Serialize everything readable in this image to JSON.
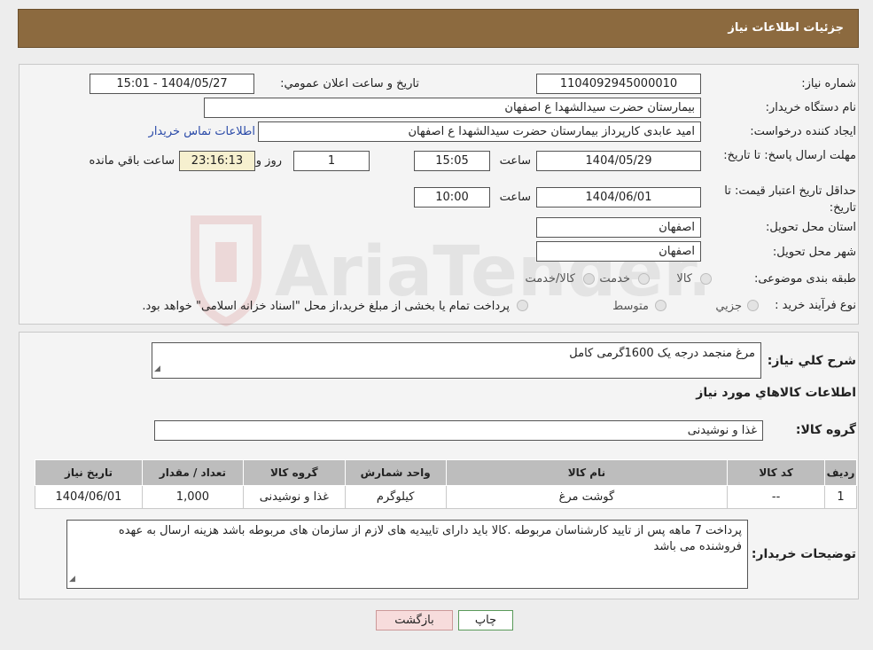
{
  "header": {
    "title": "جزئیات اطلاعات نیاز"
  },
  "need": {
    "number_label": "شماره نیاز:",
    "number": "1104092945000010",
    "announce_label": "تاریخ و ساعت اعلان عمومي:",
    "announce_value": "1404/05/27 - 15:01",
    "buyer_label": "نام دستگاه خريدار:",
    "buyer_value": "بیمارستان حضرت سیدالشهدا ع  اصفهان",
    "creator_label": "ايجاد كننده درخواست:",
    "creator_value": "امید  عابدی  کارپرداز  بیمارستان حضرت سیدالشهدا ع  اصفهان",
    "contact_link": "اطلاعات تماس خريدار",
    "deadline_label": "مهلت ارسال پاسخ: تا تاریخ:",
    "deadline_date": "1404/05/29",
    "time_label": "ساعت",
    "deadline_time": "15:05",
    "days": "1",
    "days_label": "روز و",
    "remaining": "23:16:13",
    "remaining_label": "ساعت باقي مانده",
    "validity_label": "حداقل تاريخ اعتبار قيمت: تا تاريخ:",
    "validity_date": "1404/06/01",
    "validity_time_label": "ساعت",
    "validity_time": "10:00",
    "province_label": "استان محل تحويل:",
    "province_value": "اصفهان",
    "city_label": "شهر محل تحويل:",
    "city_value": "اصفهان",
    "category_label": "طبقه بندی موضوعی:",
    "category_options": [
      "کالا",
      "خدمت",
      "کالا/خدمت"
    ],
    "process_label": "نوع فرآيند خريد :",
    "process_options": [
      "جزيي",
      "متوسط"
    ],
    "process_note": "پرداخت تمام يا بخشی از مبلغ خريد،از محل \"اسناد خزانه اسلامی\" خواهد بود."
  },
  "description": {
    "label": "شرح كلي نياز:",
    "value": "مرغ منجمد درجه یک 1600گرمی کامل"
  },
  "goods": {
    "section_title": "اطلاعات كالاهاي مورد نياز",
    "group_label": "گروه كالا:",
    "group_value": "غذا و نوشیدنی",
    "columns": [
      "رديف",
      "كد كالا",
      "نام كالا",
      "واحد شمارش",
      "گروه كالا",
      "تعداد / مقدار",
      "تاريخ نياز"
    ],
    "rows": [
      [
        "1",
        "--",
        "گوشت مرغ",
        "کیلوگرم",
        "غذا و نوشیدنی",
        "1,000",
        "1404/06/01"
      ]
    ]
  },
  "buyer_notes": {
    "label": "توضيحات خريدار:",
    "value": "پرداخت 7 ماهه پس از تایید کارشناسان مربوطه .کالا باید دارای تاییدیه های لازم از سازمان های مربوطه باشد هزینه ارسال به عهده فروشنده می باشد"
  },
  "buttons": {
    "print": "چاپ",
    "back": "بازگشت"
  },
  "watermark": {
    "text": "AriaTender.neT"
  }
}
